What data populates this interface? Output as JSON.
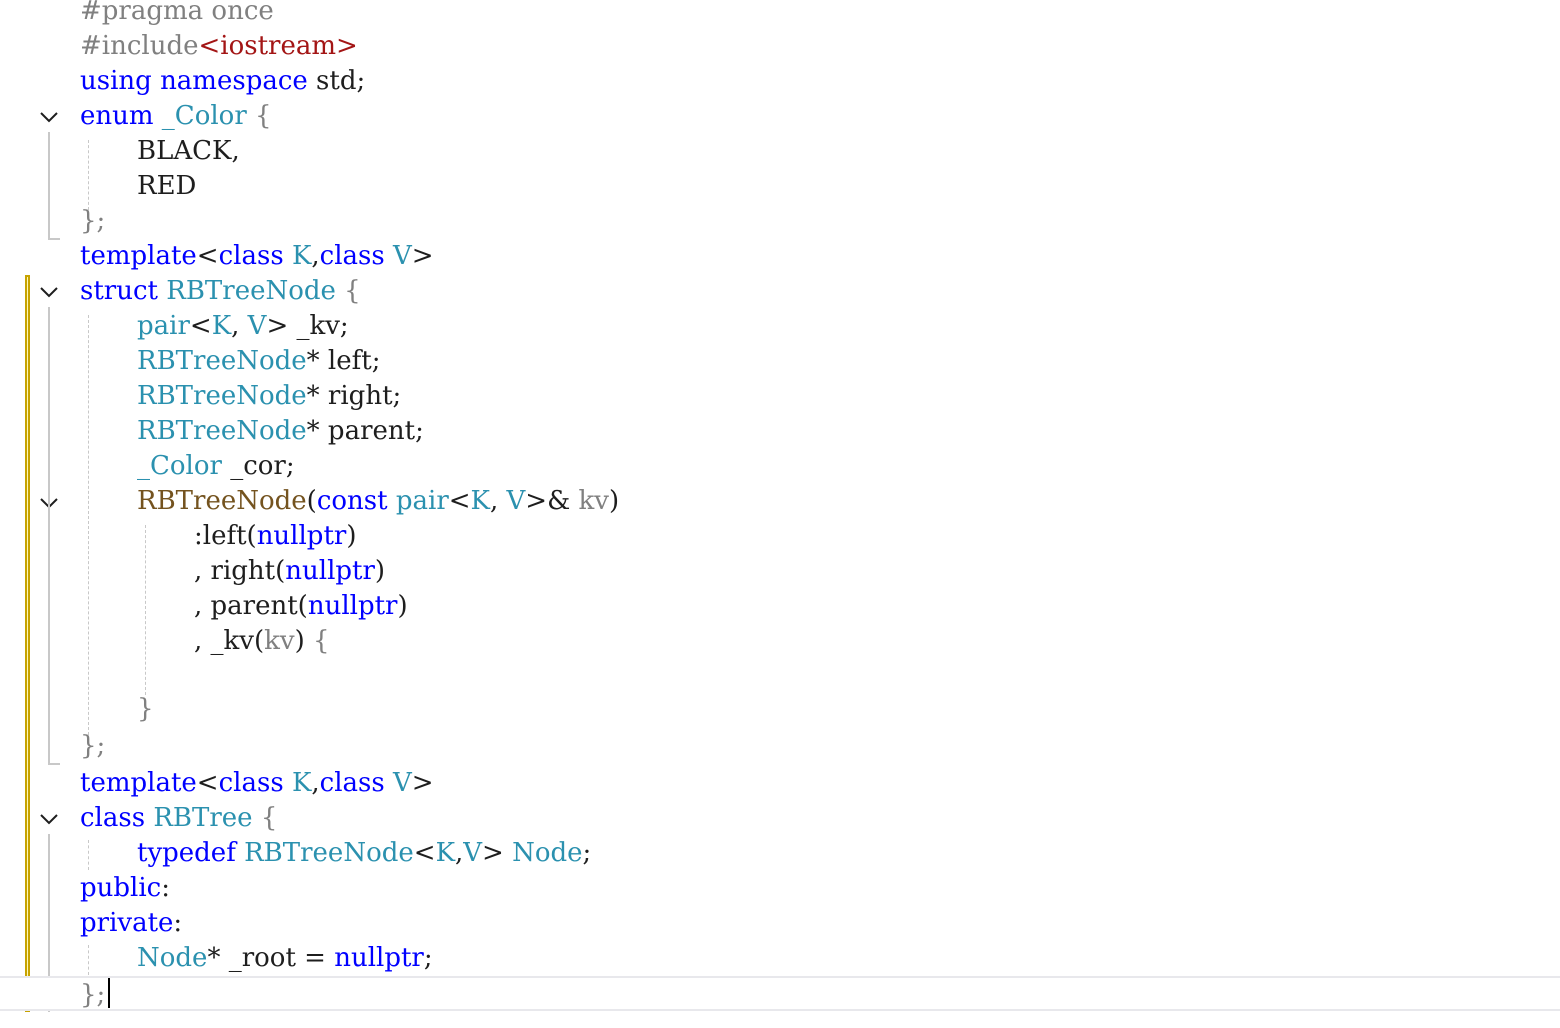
{
  "editor": {
    "lines": [
      [
        {
          "t": "#pragma once",
          "c": "pp"
        }
      ],
      [
        {
          "t": "#include",
          "c": "pp"
        },
        {
          "t": "<iostream>",
          "c": "st"
        }
      ],
      [
        {
          "t": "using",
          "c": "kw"
        },
        {
          "t": " "
        },
        {
          "t": "namespace",
          "c": "kw"
        },
        {
          "t": " std;"
        }
      ],
      [
        {
          "t": "enum",
          "c": "kw"
        },
        {
          "t": " "
        },
        {
          "t": "_Color",
          "c": "ty"
        },
        {
          "t": " {",
          "c": "pr"
        }
      ],
      [
        {
          "t": "BLACK,"
        }
      ],
      [
        {
          "t": "RED"
        }
      ],
      [
        {
          "t": "};",
          "c": "pr"
        }
      ],
      [
        {
          "t": "template",
          "c": "kw"
        },
        {
          "t": "<"
        },
        {
          "t": "class",
          "c": "kw"
        },
        {
          "t": " "
        },
        {
          "t": "K",
          "c": "ty"
        },
        {
          "t": ","
        },
        {
          "t": "class",
          "c": "kw"
        },
        {
          "t": " "
        },
        {
          "t": "V",
          "c": "ty"
        },
        {
          "t": ">"
        }
      ],
      [
        {
          "t": "struct",
          "c": "kw"
        },
        {
          "t": " "
        },
        {
          "t": "RBTreeNode",
          "c": "ty"
        },
        {
          "t": " {",
          "c": "pr"
        }
      ],
      [
        {
          "t": "pair",
          "c": "ty"
        },
        {
          "t": "<"
        },
        {
          "t": "K",
          "c": "ty"
        },
        {
          "t": ", "
        },
        {
          "t": "V",
          "c": "ty"
        },
        {
          "t": "> _kv;"
        }
      ],
      [
        {
          "t": "RBTreeNode",
          "c": "ty"
        },
        {
          "t": "* left;"
        }
      ],
      [
        {
          "t": "RBTreeNode",
          "c": "ty"
        },
        {
          "t": "* right;"
        }
      ],
      [
        {
          "t": "RBTreeNode",
          "c": "ty"
        },
        {
          "t": "* parent;"
        }
      ],
      [
        {
          "t": "_Color",
          "c": "ty"
        },
        {
          "t": " _cor;"
        }
      ],
      [
        {
          "t": "RBTreeNode",
          "c": "fn"
        },
        {
          "t": "("
        },
        {
          "t": "const",
          "c": "kw"
        },
        {
          "t": " "
        },
        {
          "t": "pair",
          "c": "ty"
        },
        {
          "t": "<"
        },
        {
          "t": "K",
          "c": "ty"
        },
        {
          "t": ", "
        },
        {
          "t": "V",
          "c": "ty"
        },
        {
          "t": ">& "
        },
        {
          "t": "kv",
          "c": "pp"
        },
        {
          "t": ")"
        }
      ],
      [
        {
          "t": ":left("
        },
        {
          "t": "nullptr",
          "c": "kw"
        },
        {
          "t": ")"
        }
      ],
      [
        {
          "t": ", right("
        },
        {
          "t": "nullptr",
          "c": "kw"
        },
        {
          "t": ")"
        }
      ],
      [
        {
          "t": ", parent("
        },
        {
          "t": "nullptr",
          "c": "kw"
        },
        {
          "t": ")"
        }
      ],
      [
        {
          "t": ", _kv("
        },
        {
          "t": "kv",
          "c": "pp"
        },
        {
          "t": ") "
        },
        {
          "t": "{",
          "c": "pr"
        }
      ],
      [],
      [
        {
          "t": "}",
          "c": "pr"
        }
      ],
      [
        {
          "t": "};",
          "c": "pr"
        }
      ],
      [
        {
          "t": "template",
          "c": "kw"
        },
        {
          "t": "<"
        },
        {
          "t": "class",
          "c": "kw"
        },
        {
          "t": " "
        },
        {
          "t": "K",
          "c": "ty"
        },
        {
          "t": ","
        },
        {
          "t": "class",
          "c": "kw"
        },
        {
          "t": " "
        },
        {
          "t": "V",
          "c": "ty"
        },
        {
          "t": ">"
        }
      ],
      [
        {
          "t": "class",
          "c": "kw"
        },
        {
          "t": " "
        },
        {
          "t": "RBTree",
          "c": "ty"
        },
        {
          "t": " {",
          "c": "pr"
        }
      ],
      [
        {
          "t": "typedef",
          "c": "kw"
        },
        {
          "t": " "
        },
        {
          "t": "RBTreeNode",
          "c": "ty"
        },
        {
          "t": "<"
        },
        {
          "t": "K",
          "c": "ty"
        },
        {
          "t": ","
        },
        {
          "t": "V",
          "c": "ty"
        },
        {
          "t": "> "
        },
        {
          "t": "Node",
          "c": "ty"
        },
        {
          "t": ";"
        }
      ],
      [
        {
          "t": "public",
          "c": "kw"
        },
        {
          "t": ":"
        }
      ],
      [
        {
          "t": "private",
          "c": "kw"
        },
        {
          "t": ":"
        }
      ],
      [
        {
          "t": "Node",
          "c": "ty"
        },
        {
          "t": "* _root = "
        },
        {
          "t": "nullptr",
          "c": "kw"
        },
        {
          "t": ";"
        }
      ],
      [
        {
          "t": "};",
          "c": "pr"
        }
      ]
    ]
  }
}
